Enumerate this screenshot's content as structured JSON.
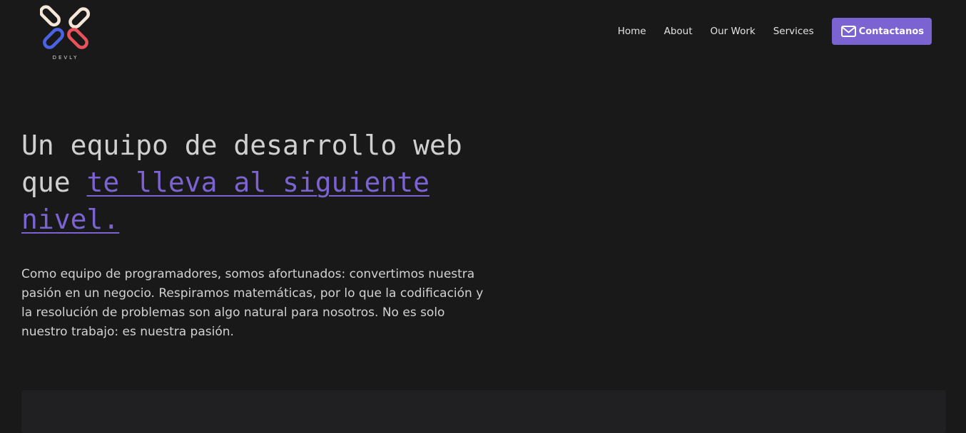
{
  "brand": {
    "name": "DEVLY",
    "colors": {
      "ring_light": "#f4e7d8",
      "ring_blue": "#4a63e4",
      "ring_red": "#e8525b"
    }
  },
  "nav": {
    "links": [
      {
        "label": "Home"
      },
      {
        "label": "About"
      },
      {
        "label": "Our Work"
      },
      {
        "label": "Services"
      }
    ],
    "cta": {
      "label": "Contactanos",
      "icon": "mail-icon"
    }
  },
  "hero": {
    "title_plain": "Un equipo de desarrollo web que ",
    "title_accent": "te lleva al siguiente nivel.",
    "description": "Como equipo de programadores, somos afortunados: convertimos nuestra pasión en un negocio. Respiramos matemáticas, por lo que la codificación y la resolución de problemas son algo natural para nosotros. No es solo nuestro trabajo: es nuestra pasión."
  },
  "colors": {
    "background": "#19191a",
    "accent": "#7b63d1",
    "text": "#d0d0d0",
    "panel": "#202023"
  }
}
